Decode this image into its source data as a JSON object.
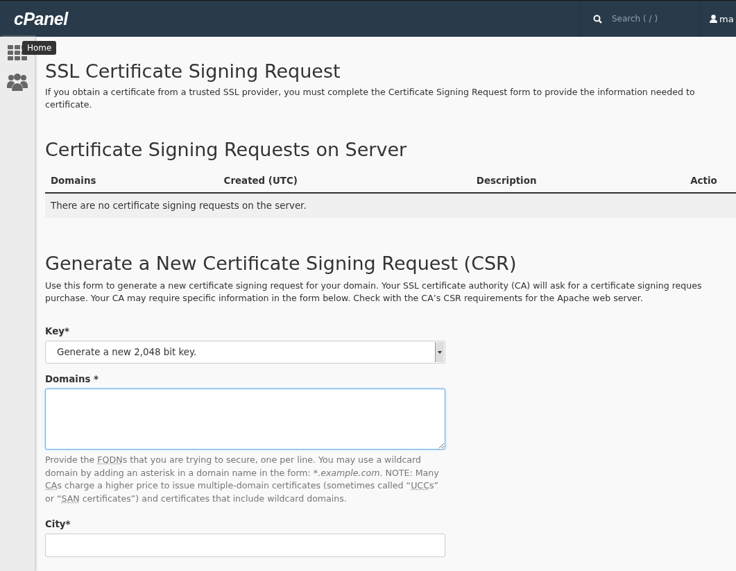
{
  "header": {
    "logo": "cPanel",
    "search": {
      "placeholder": "Search ( / )"
    },
    "user": "ma"
  },
  "sidebar": {
    "items": [
      {
        "kind": "grid"
      },
      {
        "kind": "users"
      }
    ],
    "tooltip": "Home"
  },
  "page": {
    "title": "SSL Certificate Signing Request",
    "intro_lines": [
      "If you obtain a certificate from a trusted SSL provider, you must complete the Certificate Signing Request form to provide the information needed to",
      "certificate."
    ]
  },
  "requests": {
    "title": "Certificate Signing Requests on Server",
    "columns": [
      "Domains",
      "Created (UTC)",
      "Description",
      "Actio"
    ],
    "empty": "There are no certificate signing requests on the server."
  },
  "generate": {
    "title": "Generate a New Certificate Signing Request (CSR)",
    "intro_lines": [
      "Use this form to generate a new certificate signing request for your domain. Your SSL certificate authority (CA) will ask for a certificate signing reques",
      "purchase. Your CA may require specific information in the form below. Check with the CA’s CSR requirements for the Apache web server."
    ],
    "fields": [
      {
        "kind": "select",
        "label": "Key*",
        "value": "Generate a new 2,048 bit key."
      },
      {
        "kind": "textarea",
        "label": "Domains *",
        "focused": true,
        "hint": [
          {
            "kind": "text",
            "text": "Provide the "
          },
          {
            "kind": "abbr",
            "text": "FQDN"
          },
          {
            "kind": "text",
            "text": "s that you are trying to secure, one per line. You may use a wildcard domain by adding an asterisk in a domain name in the form: "
          },
          {
            "kind": "em",
            "text": "*.example.com"
          },
          {
            "kind": "text",
            "text": ". NOTE: Many "
          },
          {
            "kind": "abbr",
            "text": "CA"
          },
          {
            "kind": "text",
            "text": "s charge a higher price to issue multiple-domain certificates (sometimes called “"
          },
          {
            "kind": "abbr",
            "text": "UCC"
          },
          {
            "kind": "text",
            "text": "s” or “"
          },
          {
            "kind": "abbr",
            "text": "SAN"
          },
          {
            "kind": "text",
            "text": " certificates”) and certificates that include wildcard domains."
          }
        ]
      },
      {
        "kind": "input",
        "label": "City*",
        "focused": false
      }
    ]
  }
}
